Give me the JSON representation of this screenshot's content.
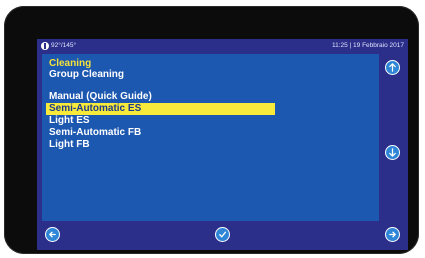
{
  "status": {
    "temperature": "92°/145°",
    "datetime": "11:25 | 19 Febbraio 2017"
  },
  "menu": {
    "title": "Cleaning",
    "items": [
      {
        "label": "Group Cleaning",
        "selected": false
      },
      {
        "label": "Manual (Quick Guide)",
        "selected": false
      },
      {
        "label": "Semi-Automatic ES",
        "selected": true
      },
      {
        "label": "Light ES",
        "selected": false
      },
      {
        "label": "Semi-Automatic FB",
        "selected": false
      },
      {
        "label": "Light FB",
        "selected": false
      }
    ]
  },
  "icons": {
    "scroll_up": "arrow-up-icon",
    "scroll_down": "arrow-down-icon",
    "back": "back-arrow-icon",
    "confirm": "checkmark-icon",
    "next": "forward-arrow-icon"
  },
  "colors": {
    "frame": "#2c2f8a",
    "panel": "#1c57b0",
    "title": "#f5e23a",
    "highlight": "#f7ea3a",
    "button": "#2f86d6"
  }
}
